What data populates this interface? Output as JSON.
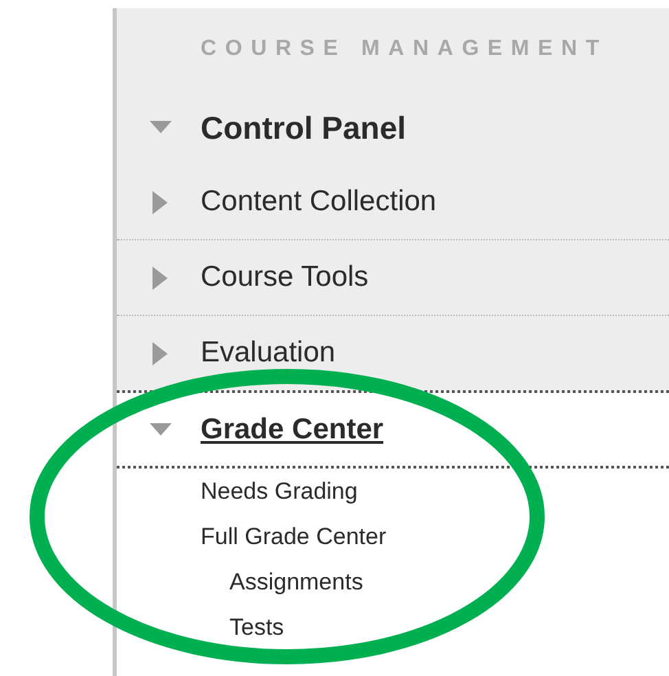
{
  "panel": {
    "heading": "COURSE MANAGEMENT",
    "title": "Control Panel",
    "expanded": true,
    "items": [
      {
        "label": "Content Collection",
        "expanded": false,
        "selected": false
      },
      {
        "label": "Course Tools",
        "expanded": false,
        "selected": false
      },
      {
        "label": "Evaluation",
        "expanded": false,
        "selected": false
      },
      {
        "label": "Grade Center",
        "expanded": true,
        "selected": true,
        "children": [
          {
            "label": "Needs Grading"
          },
          {
            "label": "Full Grade Center",
            "children": [
              {
                "label": "Assignments"
              },
              {
                "label": "Tests"
              }
            ]
          }
        ]
      }
    ]
  }
}
